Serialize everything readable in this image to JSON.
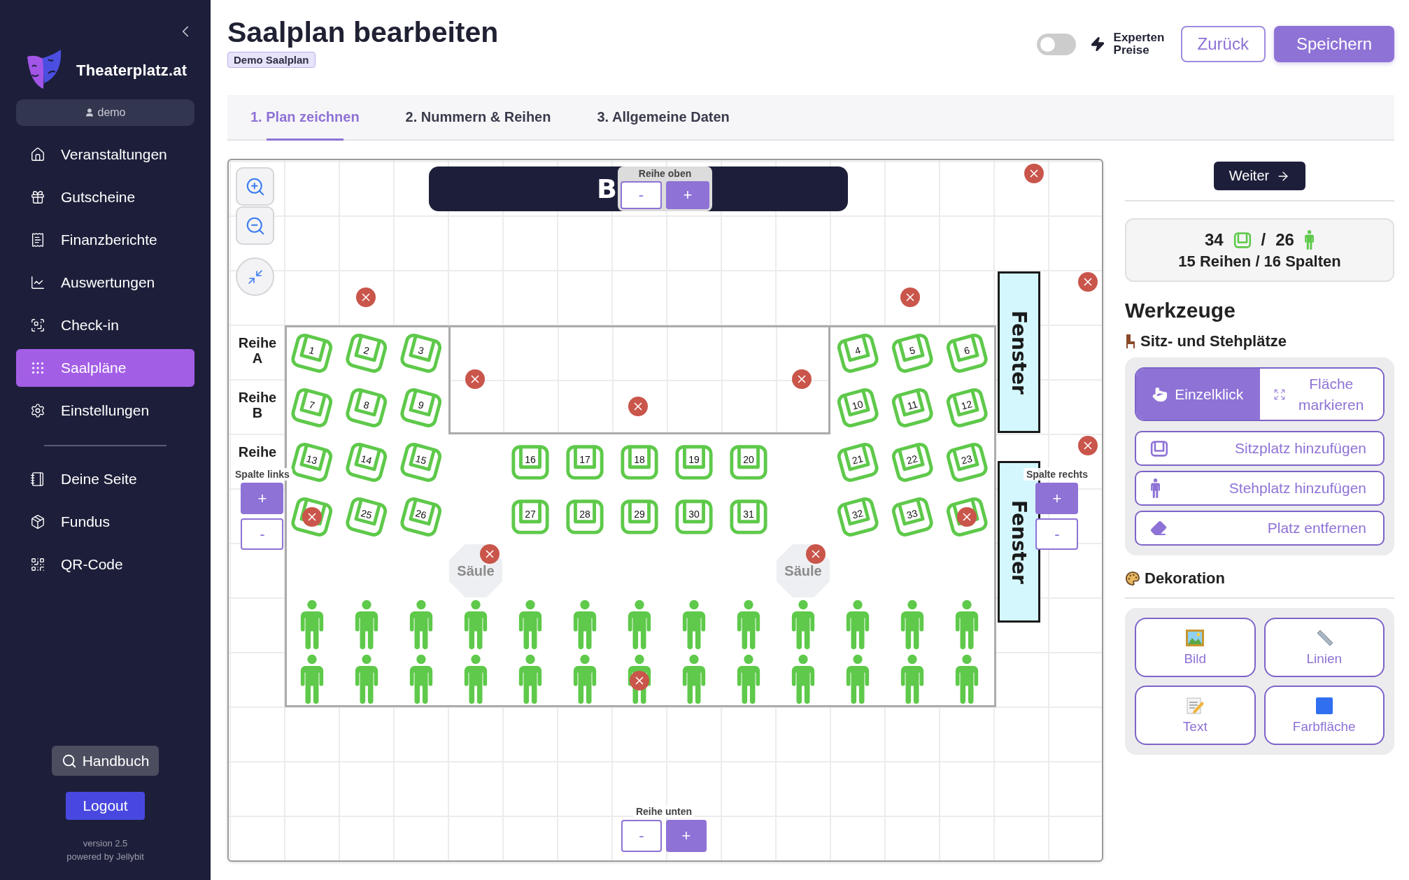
{
  "sidebar": {
    "brand": "Theaterplatz.at",
    "user": "demo",
    "nav": [
      {
        "label": "Veranstaltungen",
        "selected": false
      },
      {
        "label": "Gutscheine",
        "selected": false
      },
      {
        "label": "Finanzberichte",
        "selected": false
      },
      {
        "label": "Auswertungen",
        "selected": false
      },
      {
        "label": "Check-in",
        "selected": false
      },
      {
        "label": "Saalpläne",
        "selected": true
      },
      {
        "label": "Einstellungen",
        "selected": false
      }
    ],
    "secondary_nav": [
      {
        "label": "Deine Seite",
        "selected": false
      },
      {
        "label": "Fundus",
        "selected": false
      },
      {
        "label": "QR-Code",
        "selected": false
      }
    ],
    "help_button": "Handbuch",
    "logout_button": "Logout",
    "version": "version 2.5",
    "credit": "powered by Jellybit"
  },
  "header": {
    "title": "Saalplan bearbeiten",
    "badge": "Demo Saalplan",
    "expert_prices": {
      "label": "Experten Preise",
      "on": false
    },
    "back_button": "Zurück",
    "save_button": "Speichern"
  },
  "tabs": [
    {
      "label": "1. Plan zeichnen",
      "selected": true
    },
    {
      "label": "2. Nummern & Reihen",
      "selected": false
    },
    {
      "label": "3. Allgemeine Daten",
      "selected": false
    }
  ],
  "canvas": {
    "stage": {
      "label": "B"
    },
    "row_top_control": {
      "label": "Reihe oben",
      "minus": "-",
      "plus": "+"
    },
    "row_bottom_control": {
      "label": "Reihe unten",
      "minus": "-",
      "plus": "+"
    },
    "column_left_control": {
      "label": "Spalte links",
      "minus": "-",
      "plus": "+"
    },
    "column_right_control": {
      "label": "Spalte rechts",
      "minus": "-",
      "plus": "+"
    },
    "row_labels": [
      "Reihe A",
      "Reihe B",
      "Reihe"
    ],
    "seat_blocks": [
      {
        "kind": "clockwise",
        "seats": [
          {
            "number": "1",
            "marked": false
          },
          {
            "number": "2",
            "marked": false
          },
          {
            "number": "3",
            "marked": false
          },
          {
            "number": "7",
            "marked": false
          },
          {
            "number": "8",
            "marked": false
          },
          {
            "number": "9",
            "marked": false
          },
          {
            "number": "13",
            "marked": false
          },
          {
            "number": "14",
            "marked": false
          },
          {
            "number": "15",
            "marked": false
          },
          {
            "marked": true
          },
          {
            "number": "25",
            "marked": false
          },
          {
            "number": "26",
            "marked": false
          }
        ]
      },
      {
        "kind": "straight",
        "seats": [
          {
            "number": "16",
            "marked": false
          },
          {
            "number": "17",
            "marked": false
          },
          {
            "number": "18",
            "marked": false
          },
          {
            "number": "19",
            "marked": false
          },
          {
            "number": "20",
            "marked": false
          },
          {
            "number": "27",
            "marked": false
          },
          {
            "number": "28",
            "marked": false
          },
          {
            "number": "29",
            "marked": false
          },
          {
            "number": "30",
            "marked": false
          },
          {
            "number": "31",
            "marked": false
          }
        ]
      },
      {
        "kind": "counterclockwise",
        "seats": [
          {
            "number": "4",
            "marked": false
          },
          {
            "number": "5",
            "marked": false
          },
          {
            "number": "6",
            "marked": false
          },
          {
            "number": "10",
            "marked": false
          },
          {
            "number": "11",
            "marked": false
          },
          {
            "number": "12",
            "marked": false
          },
          {
            "number": "21",
            "marked": false
          },
          {
            "number": "22",
            "marked": false
          },
          {
            "number": "23",
            "marked": false
          },
          {
            "number": "32",
            "marked": false
          },
          {
            "number": "33",
            "marked": false
          },
          {
            "marked": true
          }
        ]
      }
    ],
    "standing_places": [
      {
        "marked": false
      },
      {
        "marked": false
      },
      {
        "marked": false
      },
      {
        "marked": false
      },
      {
        "marked": false
      },
      {
        "marked": false
      },
      {
        "marked": false
      },
      {
        "marked": false
      },
      {
        "marked": false
      },
      {
        "marked": false
      },
      {
        "marked": false
      },
      {
        "marked": false
      },
      {
        "marked": false
      },
      {
        "marked": false
      },
      {
        "marked": false
      },
      {
        "marked": false
      },
      {
        "marked": false
      },
      {
        "marked": false
      },
      {
        "marked": false
      },
      {
        "marked": true
      },
      {
        "marked": false
      },
      {
        "marked": false
      },
      {
        "marked": false
      },
      {
        "marked": false
      },
      {
        "marked": false
      },
      {
        "marked": false
      }
    ],
    "pillars": [
      {
        "label": "Säule"
      },
      {
        "label": "Säule"
      }
    ],
    "windows": [
      {
        "label": "Fenster"
      },
      {
        "label": "Fenster"
      }
    ]
  },
  "panel": {
    "next_button": "Weiter",
    "stats": {
      "seats": "34",
      "separator": "/",
      "standing": "26",
      "grid": "15 Reihen / 16 Spalten"
    },
    "tools_heading": "Werkzeuge",
    "places_heading": "Sitz- und Stehplätze",
    "modes": [
      {
        "label": "Einzelklick",
        "selected": true
      },
      {
        "label": "Fläche markieren",
        "selected": false
      }
    ],
    "actions": [
      {
        "label": "Sitzplatz hinzufügen",
        "kind": "seat"
      },
      {
        "label": "Stehplatz hinzufügen",
        "kind": "standing"
      },
      {
        "label": "Platz entfernen",
        "kind": "remove"
      }
    ],
    "decoration_heading": "Dekoration",
    "decorations": [
      {
        "label": "Bild",
        "kind": "image"
      },
      {
        "label": "Linien",
        "kind": "lines"
      },
      {
        "label": "Text",
        "kind": "text"
      },
      {
        "label": "Farbfläche",
        "kind": "fill"
      }
    ]
  }
}
